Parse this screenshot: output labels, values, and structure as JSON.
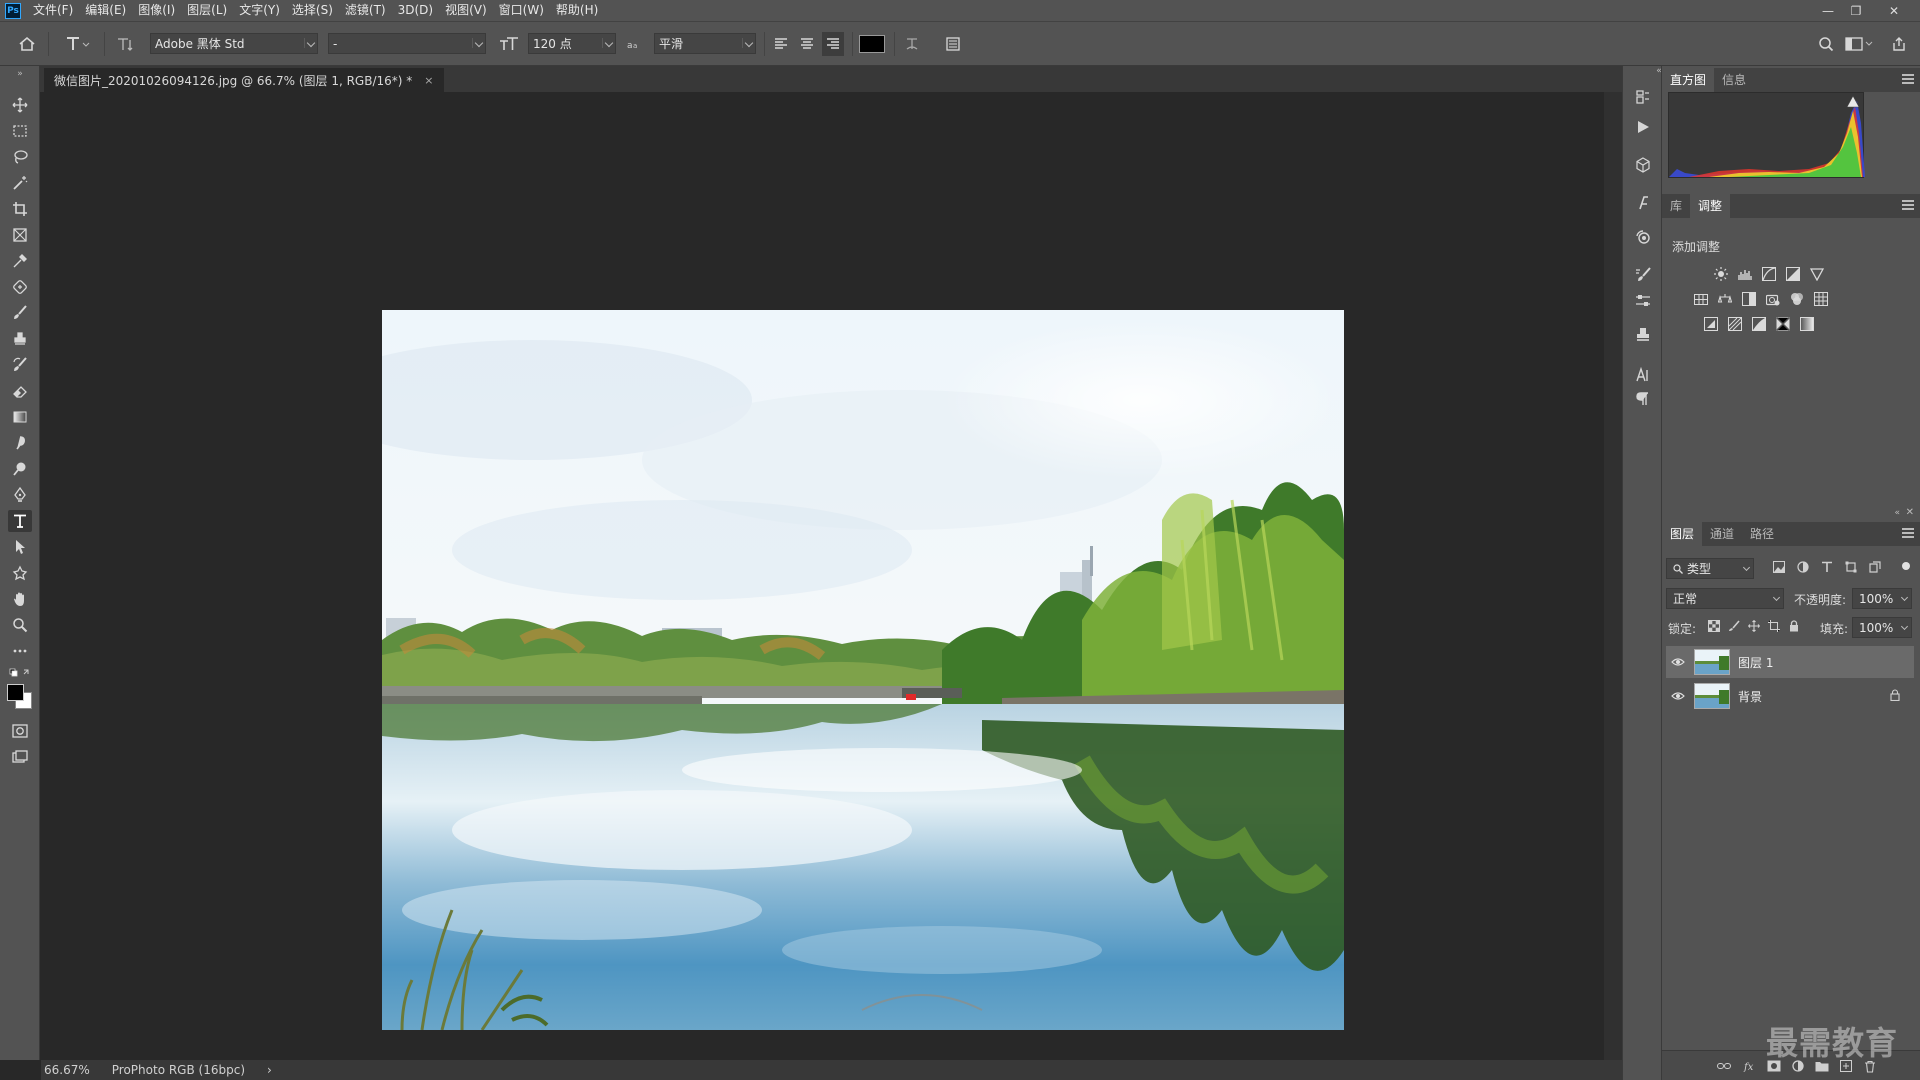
{
  "menubar": {
    "logo": "Ps",
    "items": [
      "文件(F)",
      "编辑(E)",
      "图像(I)",
      "图层(L)",
      "文字(Y)",
      "选择(S)",
      "滤镜(T)",
      "3D(D)",
      "视图(V)",
      "窗口(W)",
      "帮助(H)"
    ],
    "window_controls": [
      "—",
      "❐",
      "✕"
    ]
  },
  "options": {
    "font_family": "Adobe 黑体 Std",
    "font_style": "-",
    "font_size": "120 点",
    "antialias": "平滑",
    "text_color": "#000000"
  },
  "document": {
    "tab_title": "微信图片_20201026094126.jpg @ 66.7% (图层 1, RGB/16*) *",
    "close": "×"
  },
  "status": {
    "zoom": "66.67%",
    "color_profile": "ProPhoto RGB (16bpc)",
    "arrow": "›"
  },
  "panels": {
    "top_tabs": [
      "直方图",
      "信息"
    ],
    "mid_tabs": [
      "库",
      "调整"
    ],
    "add_adjustment_label": "添加调整",
    "layers_tabs": [
      "图层",
      "通道",
      "路径"
    ],
    "filter_kind": "类型",
    "blend_mode": "正常",
    "opacity_label": "不透明度:",
    "opacity_value": "100%",
    "lock_label": "锁定:",
    "fill_label": "填充:",
    "fill_value": "100%",
    "layers": [
      {
        "name": "图层 1",
        "visible": true,
        "selected": true,
        "locked": false
      },
      {
        "name": "背景",
        "visible": true,
        "selected": false,
        "locked": true
      }
    ]
  },
  "watermark": "最需教育",
  "colors": {
    "ui_bg": "#535353",
    "canvas_bg": "#282828",
    "foreground": "#000000",
    "background": "#ffffff"
  }
}
